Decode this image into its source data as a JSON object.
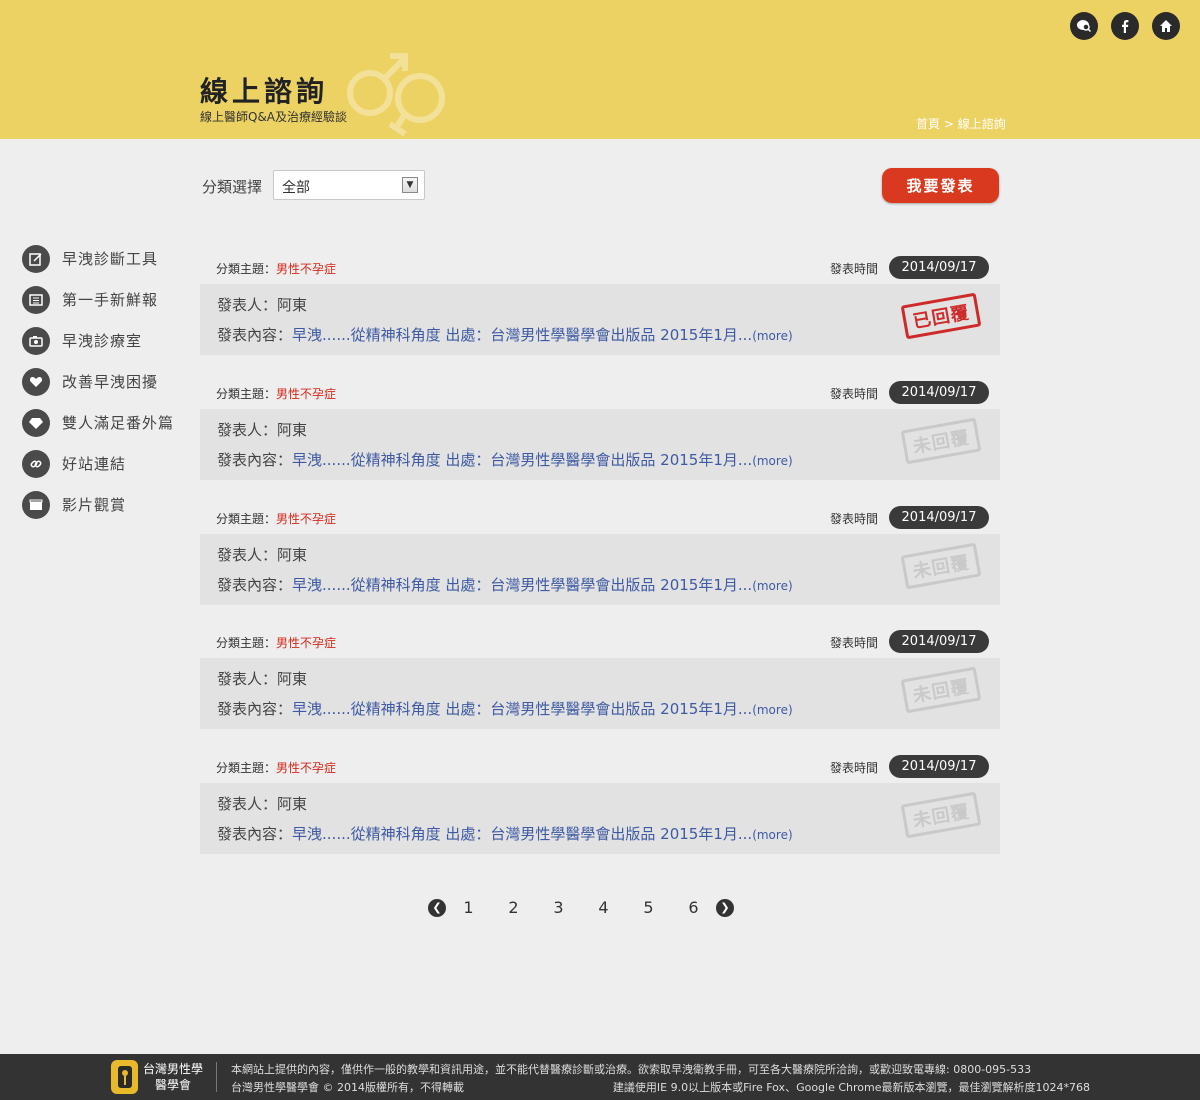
{
  "header": {
    "title": "線上諮詢",
    "subtitle": "線上醫師Q&A及治療經驗談",
    "breadcrumb": {
      "home": "首頁",
      "sep": " > ",
      "current": "線上諮詢"
    },
    "top_icons": [
      "chat-search-icon",
      "facebook-icon",
      "home-icon"
    ]
  },
  "filter": {
    "label": "分類選擇",
    "selected": "全部",
    "post_button": "我要發表"
  },
  "sidebar": {
    "items": [
      {
        "label": "早洩診斷工具",
        "icon": "edit-icon"
      },
      {
        "label": "第一手新鮮報",
        "icon": "newspaper-icon"
      },
      {
        "label": "早洩診療室",
        "icon": "camera-icon"
      },
      {
        "label": "改善早洩困擾",
        "icon": "heart-icon"
      },
      {
        "label": "雙人滿足番外篇",
        "icon": "diamond-icon"
      },
      {
        "label": "好站連結",
        "icon": "link-icon"
      },
      {
        "label": "影片觀賞",
        "icon": "film-icon"
      }
    ]
  },
  "post_labels": {
    "category": "分類主題：",
    "time": "發表時間",
    "author": "發表人：",
    "content": "發表內容：",
    "more": "(more)"
  },
  "posts": [
    {
      "category": "男性不孕症",
      "date": "2014/09/17",
      "author": "阿東",
      "content": "早洩......從精神科角度 出處：台灣男性學醫學會出版品 2015年1月...",
      "status": "已回覆"
    },
    {
      "category": "男性不孕症",
      "date": "2014/09/17",
      "author": "阿東",
      "content": "早洩......從精神科角度 出處：台灣男性學醫學會出版品 2015年1月...",
      "status": "未回覆"
    },
    {
      "category": "男性不孕症",
      "date": "2014/09/17",
      "author": "阿東",
      "content": "早洩......從精神科角度 出處：台灣男性學醫學會出版品 2015年1月...",
      "status": "未回覆"
    },
    {
      "category": "男性不孕症",
      "date": "2014/09/17",
      "author": "阿東",
      "content": "早洩......從精神科角度 出處：台灣男性學醫學會出版品 2015年1月...",
      "status": "未回覆"
    },
    {
      "category": "男性不孕症",
      "date": "2014/09/17",
      "author": "阿東",
      "content": "早洩......從精神科角度 出處：台灣男性學醫學會出版品 2015年1月...",
      "status": "未回覆"
    }
  ],
  "pagination": {
    "pages": [
      "1",
      "2",
      "3",
      "4",
      "5",
      "6"
    ]
  },
  "footer": {
    "org_line1": "台灣男性學",
    "org_line2": "醫學會",
    "notice": "本網站上提供的內容，僅供作一般的教學和資訊用途，並不能代替醫療診斷或治療。欲索取早洩衛教手冊，可至各大醫療院所洽詢，或歡迎致電專線: 0800-095-533",
    "copyright": "台灣男性學醫學會 © 2014版權所有，不得轉載",
    "browser": "建議使用IE 9.0以上版本或Fire Fox、Google Chrome最新版本瀏覽，最佳瀏覽解析度1024*768"
  },
  "colors": {
    "header_bg": "#ecd263",
    "accent_red": "#d93a1f",
    "link_blue": "#3f5aa3",
    "category_red": "#d32a1a"
  }
}
